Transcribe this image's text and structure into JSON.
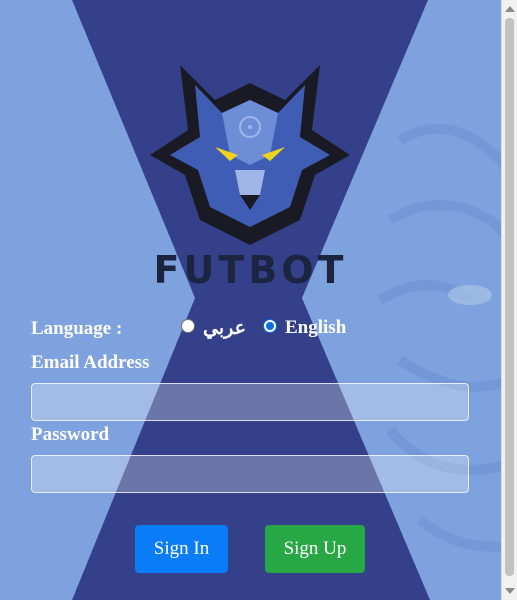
{
  "brand": {
    "name": "FUTBOT",
    "logo_icon": "wolf-head-icon"
  },
  "language": {
    "label": "Language :",
    "options": [
      {
        "label": "عربي",
        "selected": false
      },
      {
        "label": "English",
        "selected": true
      }
    ]
  },
  "form": {
    "email_label": "Email Address",
    "email_value": "",
    "password_label": "Password",
    "password_value": ""
  },
  "buttons": {
    "signin": "Sign In",
    "signup": "Sign Up"
  },
  "colors": {
    "background_light": "#7ea2de",
    "background_dark": "#34418a",
    "signin": "#0a7cf8",
    "signup": "#28a745",
    "brand_text": "#1b2540"
  }
}
